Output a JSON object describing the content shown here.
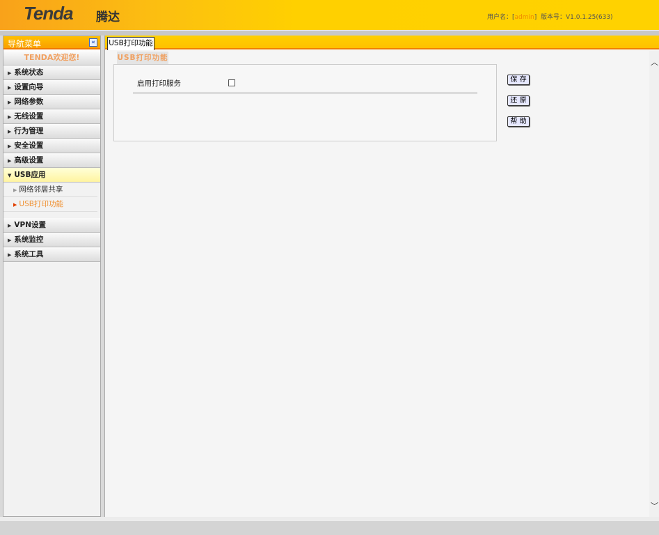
{
  "header": {
    "logo": "Tenda",
    "logo_cn": "腾达",
    "user_label": "用户名：[",
    "user": "admin",
    "user_close": "]",
    "version_label": "版本号：",
    "version": "V1.0.1.25(633)"
  },
  "sidebar": {
    "title": "导航菜单",
    "collapse": "«",
    "welcome": "TENDA欢迎您!",
    "items": [
      {
        "label": "系统状态"
      },
      {
        "label": "设置向导"
      },
      {
        "label": "网络参数"
      },
      {
        "label": "无线设置"
      },
      {
        "label": "行为管理"
      },
      {
        "label": "安全设置"
      },
      {
        "label": "高级设置"
      },
      {
        "label": "USB应用"
      }
    ],
    "subs": [
      {
        "label": "网络邻居共享"
      },
      {
        "label": "USB打印功能"
      }
    ],
    "items2": [
      {
        "label": "VPN设置"
      },
      {
        "label": "系统监控"
      },
      {
        "label": "系统工具"
      }
    ]
  },
  "main": {
    "tab": "USB打印功能",
    "section": "USB打印功能",
    "enable_label": "启用打印服务",
    "enable_checked": false,
    "save": "保 存",
    "restore": "还 原",
    "help": "帮 助"
  }
}
